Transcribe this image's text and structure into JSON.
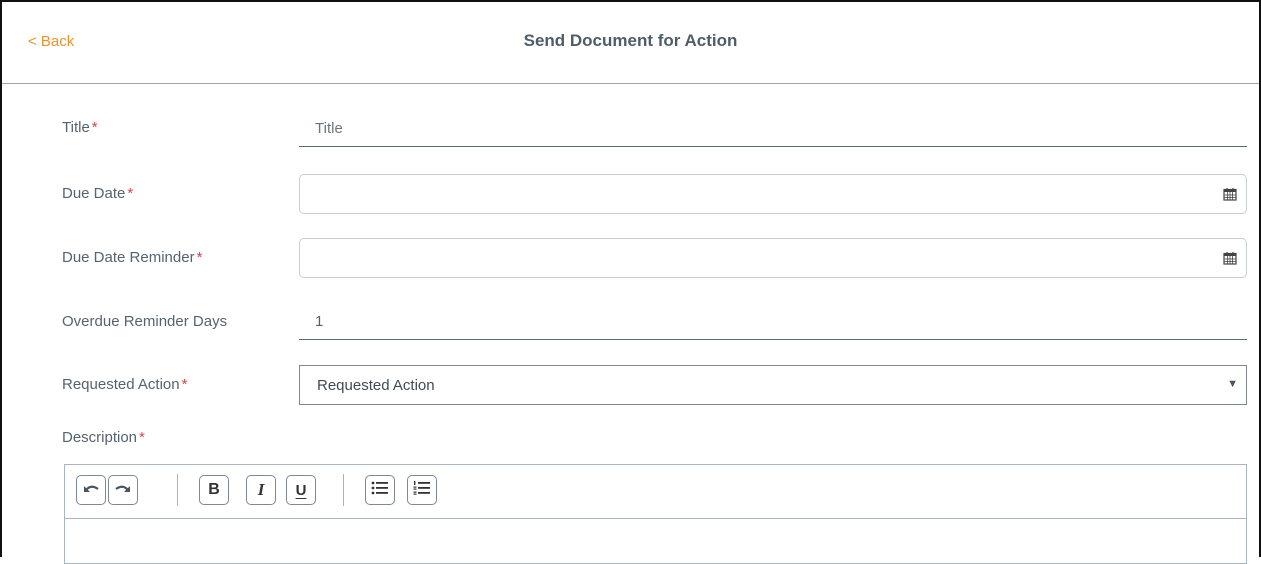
{
  "header": {
    "back_label": "< Back",
    "title": "Send Document for Action"
  },
  "form": {
    "required_marker": "*",
    "title_label": "Title",
    "title_placeholder": "Title",
    "title_value": "",
    "due_date_label": "Due Date",
    "due_date_value": "",
    "due_date_reminder_label": "Due Date Reminder",
    "due_date_reminder_value": "",
    "overdue_reminder_days_label": "Overdue Reminder Days",
    "overdue_reminder_days_value": "1",
    "requested_action_label": "Requested Action",
    "requested_action_selected": "Requested Action",
    "description_label": "Description"
  },
  "editor_toolbar": {
    "buttons": [
      "undo-icon",
      "redo-icon",
      "bold-icon",
      "italic-icon",
      "underline-icon",
      "bulleted-list-icon",
      "numbered-list-icon"
    ]
  },
  "colors": {
    "accent": "#e8932a",
    "required": "#d9434c",
    "title_text": "#4f5d6b"
  }
}
